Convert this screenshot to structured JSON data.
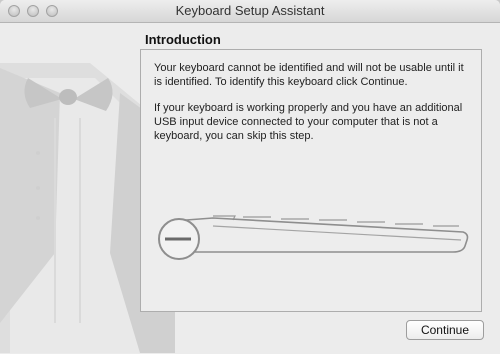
{
  "window": {
    "title": "Keyboard Setup Assistant",
    "controls": [
      "close-button",
      "minimize-button",
      "zoom-button"
    ]
  },
  "main": {
    "heading": "Introduction",
    "paragraphs": [
      "Your keyboard cannot be identified and will not be usable until it is identified. To identify this keyboard click Continue.",
      "If your keyboard is working properly and you have an additional USB input device connected to your computer that is not a keyboard, you can skip this step."
    ],
    "illustration": "keyboard-outline-icon"
  },
  "background": {
    "illustration": "tuxedo-bowtie-icon"
  },
  "footer": {
    "continue_label": "Continue"
  },
  "colors": {
    "window_bg": "#ececec",
    "panel_border": "#adadad"
  }
}
